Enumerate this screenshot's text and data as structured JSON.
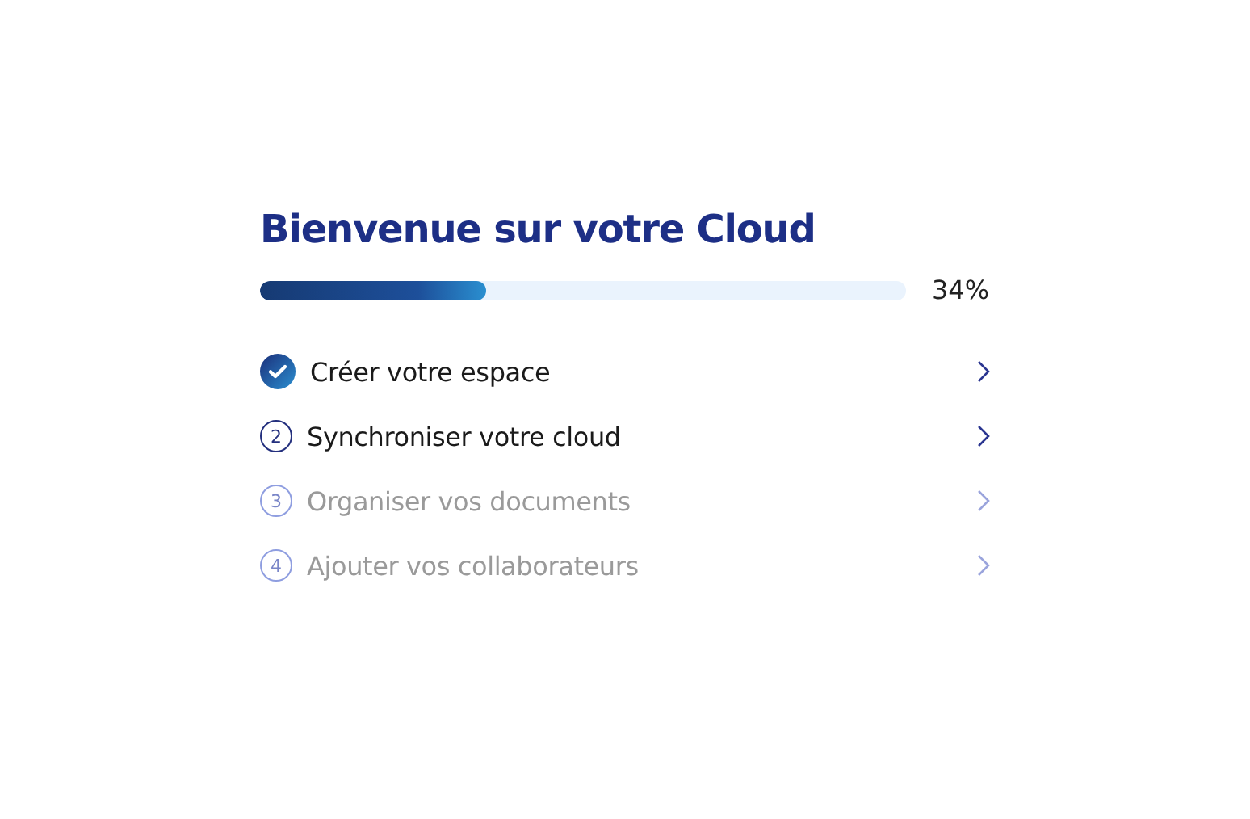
{
  "title": "Bienvenue sur votre Cloud",
  "progress": {
    "level": 0.35,
    "reading": "34%"
  },
  "steps": [
    {
      "label": "Créer votre espace",
      "done": true,
      "disabled": false
    },
    {
      "number": "2",
      "label": "Synchroniser votre cloud",
      "done": false,
      "disabled": false
    },
    {
      "number": "3",
      "label": "Organiser vos documents",
      "done": false,
      "disabled": true
    },
    {
      "number": "4",
      "label": "Ajouter vos collaborateurs",
      "done": false,
      "disabled": true
    }
  ]
}
